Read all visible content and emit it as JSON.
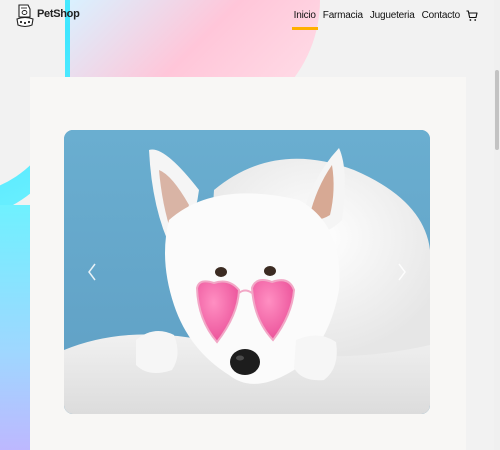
{
  "brand": {
    "name": "PetShop",
    "logo_icon": "pet-food-bowl-icon"
  },
  "nav": {
    "items": [
      {
        "label": "Inicio",
        "active": true
      },
      {
        "label": "Farmacia",
        "active": false
      },
      {
        "label": "Jugueteria",
        "active": false
      },
      {
        "label": "Contacto",
        "active": false
      }
    ],
    "cart_icon": "shopping-cart-icon",
    "active_color": "#ffb000"
  },
  "carousel": {
    "slide_description_icon": "white-dog-pink-heart-sunglasses-image",
    "prev_icon": "chevron-left-icon",
    "next_icon": "chevron-right-icon"
  },
  "colors": {
    "background": "#f2f2f2",
    "accent": "#ffb000",
    "blob_cyan": "#3fe6ff",
    "blob_pink": "#ffc6d9"
  }
}
